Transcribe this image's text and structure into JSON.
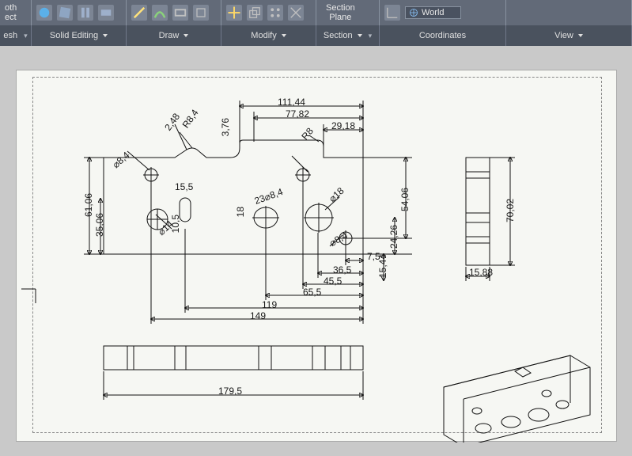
{
  "ribbon": {
    "section_plane": {
      "line1": "Section",
      "line2": "Plane"
    },
    "world_selector": "World"
  },
  "panels": {
    "p0_label": "oth",
    "p0_label2": "ect",
    "p1_label": "esh",
    "p2_label": "Solid Editing",
    "p3_label": "Draw",
    "p4_label": "Modify",
    "p5_label": "Section",
    "p6_label": "Coordinates",
    "p7_label": "View"
  },
  "dims": {
    "d_111_44": "111,44",
    "d_77_82": "77,82",
    "d_29_18": "29,18",
    "d_2_48": "2,48",
    "d_R8_4": "R8,4",
    "d_3_76": "3,76",
    "d_R8": "R8",
    "d_phi8_4a": "⌀8,4",
    "d_15_5": "15,5",
    "d_23phi8_4": "23⌀8,4",
    "d_phi18": "⌀18",
    "d_phi14": "⌀14",
    "d_18": "18",
    "d_10_5": "10,5",
    "d_phi8_4b": "⌀8,4",
    "d_7_5": "7,5",
    "d_36_5": "36,5",
    "d_45_5": "45,5",
    "d_65_5": "65,5",
    "d_119": "119",
    "d_149": "149",
    "d_35_06": "35,06",
    "d_61_06": "61,06",
    "d_15_44": "15,44",
    "d_24_26": "24,26",
    "d_54_06": "54,06",
    "d_70_02": "70,02",
    "d_15_88": "15,88",
    "d_179_5": "179,5"
  }
}
